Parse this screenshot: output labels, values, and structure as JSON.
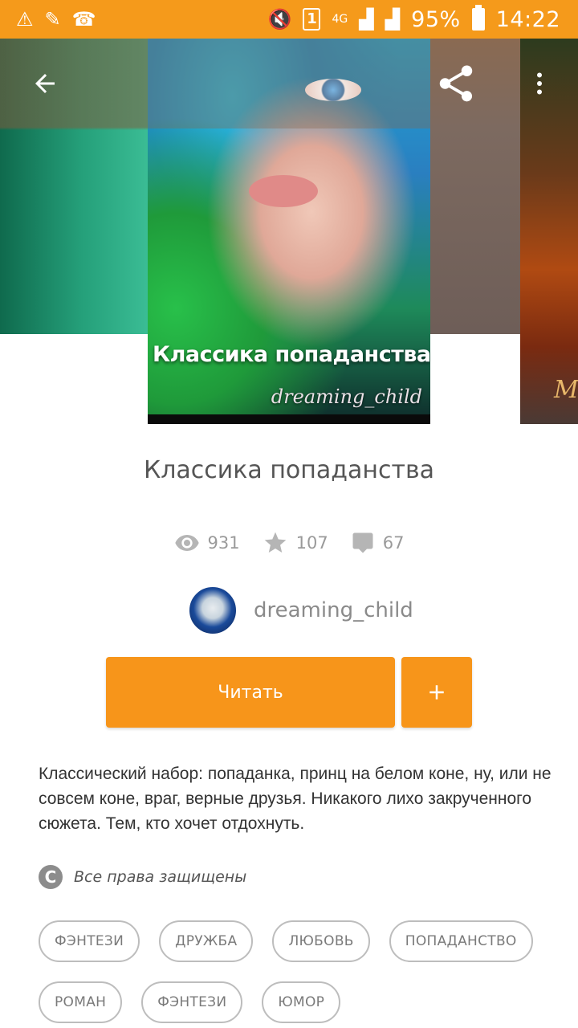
{
  "status_bar": {
    "sim_label": "1",
    "network": "4G",
    "battery": "95%",
    "time": "14:22"
  },
  "cover": {
    "title": "Классика попаданства",
    "author": "dreaming_child",
    "next_cover_text": "M"
  },
  "book": {
    "title": "Классика попаданства",
    "views": "931",
    "likes": "107",
    "comments": "67",
    "author": "dreaming_child"
  },
  "actions": {
    "read_label": "Читать",
    "add_label": "+"
  },
  "description": "Классический набор: попаданка, принц на белом коне, ну, или не совсем коне, враг, верные друзья. Никакого лихо закрученного сюжета. Тем, кто хочет отдохнуть.",
  "rights": {
    "icon": "copyright-icon",
    "text": "Все права защищены"
  },
  "tags": [
    "ФЭНТЕЗИ",
    "ДРУЖБА",
    "ЛЮБОВЬ",
    "ПОПАДАНСТВО",
    "РОМАН",
    "ФЭНТЕЗИ",
    "ЮМОР"
  ],
  "colors": {
    "accent": "#f7951a",
    "status_bar": "#f59a1b"
  }
}
